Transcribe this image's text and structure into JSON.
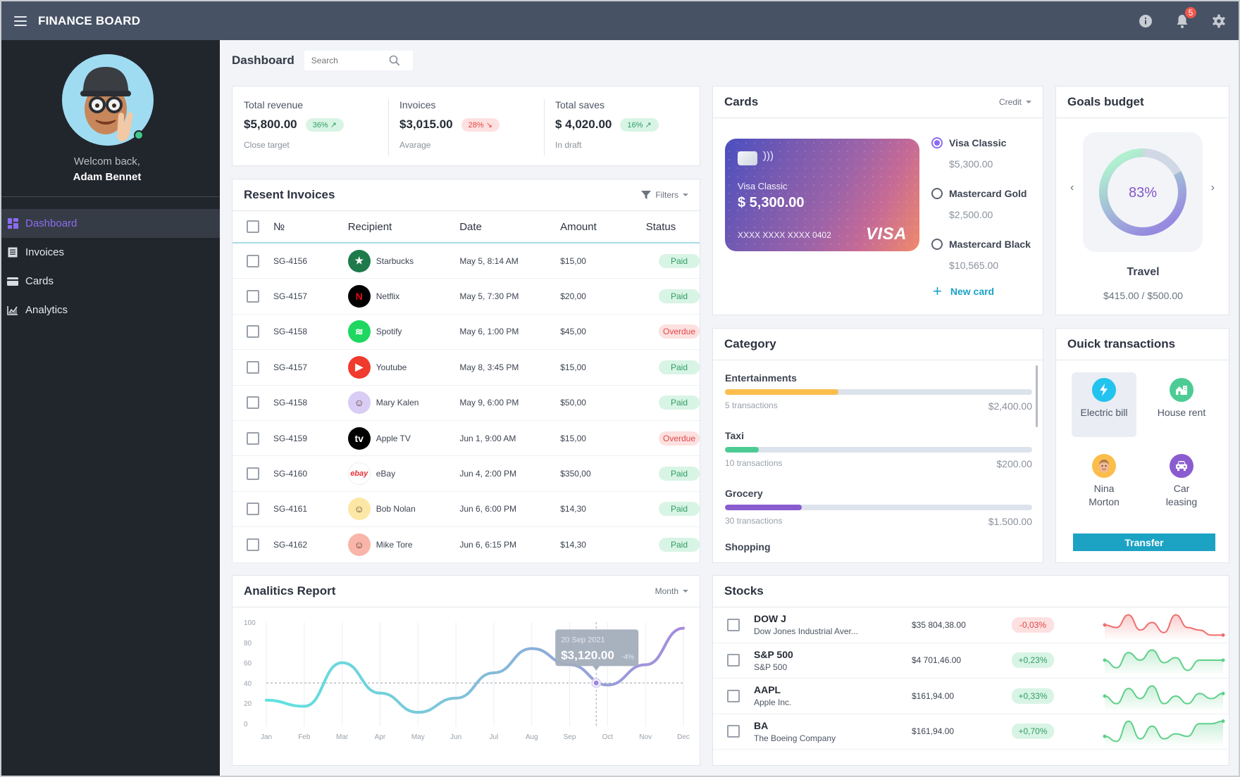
{
  "app": {
    "title": "FINANCE BOARD",
    "notifications_count": "5"
  },
  "icons": {
    "menu": "hamburger-icon",
    "info": "info-icon",
    "bell": "bell-icon",
    "settings": "gear-icon",
    "search": "search-icon",
    "filter": "filter-icon"
  },
  "user": {
    "welcome": "Welcom back,",
    "name": "Adam Bennet",
    "status": "online"
  },
  "sidebar": {
    "items": [
      {
        "label": "Dashboard",
        "icon": "dashboard-icon",
        "active": true
      },
      {
        "label": "Invoices",
        "icon": "invoice-icon",
        "active": false
      },
      {
        "label": "Cards",
        "icon": "card-icon",
        "active": false
      },
      {
        "label": "Analytics",
        "icon": "analytics-icon",
        "active": false
      }
    ]
  },
  "page": {
    "title": "Dashboard",
    "search_placeholder": "Search"
  },
  "stats": [
    {
      "label": "Total revenue",
      "value": "$5,800.00",
      "change": "36%",
      "trend": "up",
      "sub": "Close target"
    },
    {
      "label": "Invoices",
      "value": "$3,015.00",
      "change": "28%",
      "trend": "down",
      "sub": "Avarage"
    },
    {
      "label": "Total saves",
      "value": "$ 4,020.00",
      "change": "16%",
      "trend": "up",
      "sub": "In draft"
    }
  ],
  "invoices": {
    "title": "Resent Invoices",
    "filters_label": "Filters",
    "columns": [
      "№",
      "Recipient",
      "Date",
      "Amount",
      "Status"
    ],
    "rows": [
      {
        "no": "SG-4156",
        "recipient": "Starbucks",
        "date": "May 5, 8:14 AM",
        "amount": "$15,00",
        "status": "Paid"
      },
      {
        "no": "SG-4157",
        "recipient": "Netflix",
        "date": "May 5, 7:30 PM",
        "amount": "$20,00",
        "status": "Paid"
      },
      {
        "no": "SG-4158",
        "recipient": "Spotify",
        "date": "May 6, 1:00 PM",
        "amount": "$45,00",
        "status": "Overdue"
      },
      {
        "no": "SG-4157",
        "recipient": "Youtube",
        "date": "May 8, 3:45 PM",
        "amount": "$15,00",
        "status": "Paid"
      },
      {
        "no": "SG-4158",
        "recipient": "Mary Kalen",
        "date": "May 9, 6:00 PM",
        "amount": "$50,00",
        "status": "Paid"
      },
      {
        "no": "SG-4159",
        "recipient": "Apple TV",
        "date": "Jun 1, 9:00 AM",
        "amount": "$15,00",
        "status": "Overdue"
      },
      {
        "no": "SG-4160",
        "recipient": "eBay",
        "date": "Jun 4, 2:00 PM",
        "amount": "$350,00",
        "status": "Paid"
      },
      {
        "no": "SG-4161",
        "recipient": "Bob Nolan",
        "date": "Jun 6, 6:00 PM",
        "amount": "$14,30",
        "status": "Paid"
      },
      {
        "no": "SG-4162",
        "recipient": "Mike Tore",
        "date": "Jun 6, 6:15 PM",
        "amount": "$14,30",
        "status": "Paid"
      }
    ]
  },
  "cards": {
    "title": "Cards",
    "type_label": "Credit",
    "active_card": {
      "name": "Visa Classic",
      "balance": "$ 5,300.00",
      "number": "XXXX XXXX XXXX 0402",
      "brand": "VISA"
    },
    "options": [
      {
        "name": "Visa Classic",
        "amount": "$5,300.00",
        "selected": true
      },
      {
        "name": "Mastercard Gold",
        "amount": "$2,500.00",
        "selected": false
      },
      {
        "name": "Mastercard Black",
        "amount": "$10,565.00",
        "selected": false
      }
    ],
    "new_card_label": "New card"
  },
  "goals": {
    "title": "Goals budget",
    "percent": 83,
    "percent_label": "83%",
    "name": "Travel",
    "progress_text": "$415.00 / $500.00"
  },
  "category": {
    "title": "Category",
    "items": [
      {
        "name": "Entertainments",
        "transactions": "5 transactions",
        "amount": "$2,400.00",
        "progress": 0.37,
        "color": "#fbbd4c"
      },
      {
        "name": "Taxi",
        "transactions": "10 transactions",
        "amount": "$200.00",
        "progress": 0.11,
        "color": "#4ccc94"
      },
      {
        "name": "Grocery",
        "transactions": "30 transactions",
        "amount": "$1.500.00",
        "progress": 0.25,
        "color": "#8a5cd0"
      },
      {
        "name": "Shopping"
      }
    ]
  },
  "quick": {
    "title": "Ouick transactions",
    "items": [
      {
        "label": "Electric bill",
        "icon": "lightning-icon",
        "color": "#22c3ee",
        "selected": true
      },
      {
        "label": "House rent",
        "icon": "house-icon",
        "color": "#4ccc94",
        "selected": false
      },
      {
        "label": "Nina Morton",
        "icon": "person-avatar",
        "color": "#fbbd4c",
        "selected": false
      },
      {
        "label": "Car leasing",
        "icon": "car-icon",
        "color": "#8a5cd0",
        "selected": false
      }
    ],
    "transfer_label": "Transfer"
  },
  "analytics": {
    "title": "Analitics Report",
    "period_label": "Month",
    "tooltip": {
      "date": "20 Sep 2021",
      "value": "$3,120.00",
      "change": "-4%"
    }
  },
  "chart_data": {
    "type": "line",
    "title": "Analitics Report",
    "categories": [
      "Jan",
      "Feb",
      "Mar",
      "Apr",
      "May",
      "Jun",
      "Jul",
      "Aug",
      "Sep",
      "Oct",
      "Nov",
      "Dec"
    ],
    "x": [
      0,
      1,
      2,
      3,
      4,
      5,
      6,
      7,
      8,
      9,
      10,
      11
    ],
    "values": [
      23,
      17,
      60,
      30,
      11,
      25,
      50,
      74,
      58,
      38,
      58,
      94
    ],
    "yticks": [
      0,
      20,
      40,
      60,
      80,
      100
    ],
    "ylim": [
      0,
      100
    ],
    "grid": "vertical",
    "reference_line": 40,
    "highlight": {
      "x": 8.7,
      "y": 40,
      "label": "20 Sep 2021",
      "value": "$3,120.00",
      "change": "-4%"
    },
    "xlabel": "",
    "ylabel": ""
  },
  "stocks": {
    "title": "Stocks",
    "rows": [
      {
        "ticker": "DOW J",
        "name": "Dow Jones Industrial Aver...",
        "price": "$35 804,38.00",
        "change": "-0,03%",
        "trend": "down",
        "spark": [
          5,
          4,
          9,
          3,
          6,
          2,
          9,
          4,
          3,
          1,
          1
        ]
      },
      {
        "ticker": "S&P 500",
        "name": "S&P 500",
        "price": "$4 701,46.00",
        "change": "+0,23%",
        "trend": "up",
        "spark": [
          5,
          2,
          8,
          5,
          9,
          4,
          6,
          1,
          5,
          5,
          5
        ]
      },
      {
        "ticker": "AAPL",
        "name": "Apple Inc.",
        "price": "$161,94.00",
        "change": "+0,33%",
        "trend": "up",
        "spark": [
          5,
          2,
          8,
          4,
          9,
          2,
          5,
          2,
          6,
          4,
          6
        ]
      },
      {
        "ticker": "BA",
        "name": "The Boeing Company",
        "price": "$161,94.00",
        "change": "+0,70%",
        "trend": "up",
        "spark": [
          3,
          1,
          9,
          2,
          7,
          2,
          4,
          3,
          8,
          8,
          9
        ]
      }
    ]
  },
  "colors": {
    "accent": "#8b6cf0",
    "topbar": "#475265",
    "sidebar": "#21252c",
    "paid": "#2f9e63",
    "overdue": "#e24646",
    "transfer": "#1ca3c4"
  }
}
